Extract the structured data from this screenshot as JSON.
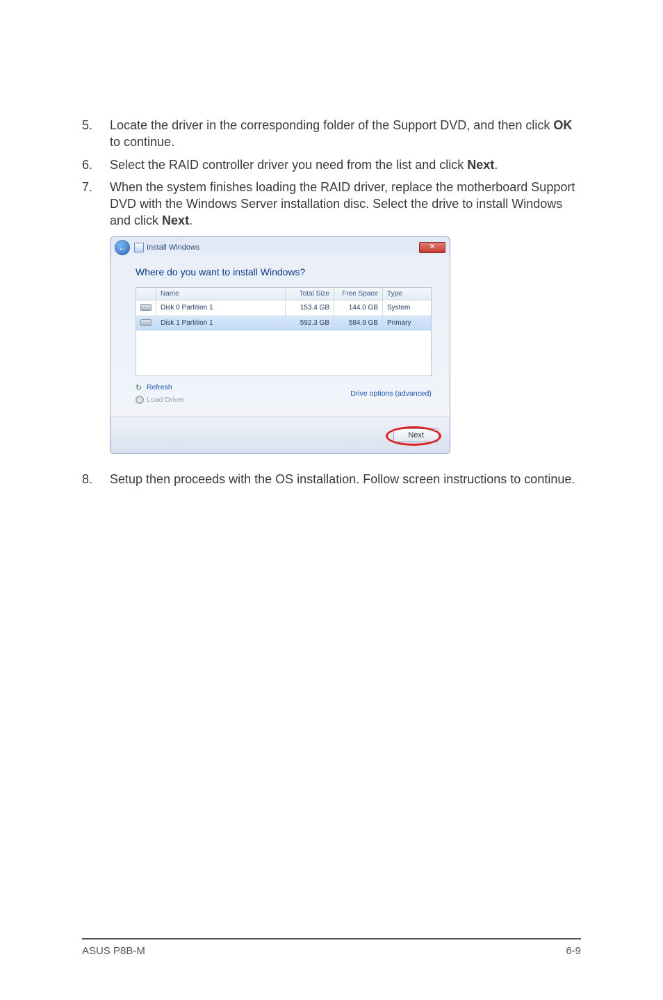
{
  "steps": {
    "5": {
      "num": "5.",
      "text_before": "Locate the driver in the corresponding folder of the Support DVD, and then click ",
      "bold1": "OK",
      "text_after": " to continue."
    },
    "6": {
      "num": "6.",
      "text_before": "Select the RAID controller driver you need from the list and click ",
      "bold1": "Next",
      "text_after": "."
    },
    "7": {
      "num": "7.",
      "text_before": "When the system finishes loading the RAID driver, replace the motherboard Support DVD with the Windows Server installation disc. Select the drive to install Windows and click ",
      "bold1": "Next",
      "text_after": "."
    },
    "8": {
      "num": "8.",
      "text": "Setup then proceeds with the OS installation. Follow screen instructions to continue."
    }
  },
  "dialog": {
    "title": "Install Windows",
    "heading": "Where do you want to install Windows?",
    "columns": {
      "name": "Name",
      "total": "Total Size",
      "free": "Free Space",
      "type": "Type"
    },
    "rows": [
      {
        "name": "Disk 0 Partition 1",
        "total": "153.4 GB",
        "free": "144.0 GB",
        "type": "System",
        "selected": false
      },
      {
        "name": "Disk 1 Partition 1",
        "total": "592.3 GB",
        "free": "584.9 GB",
        "type": "Primary",
        "selected": true
      }
    ],
    "refresh": "Refresh",
    "load_driver": "Load Driver",
    "drive_options": "Drive options (advanced)",
    "next": "Next"
  },
  "footer": {
    "left": "ASUS P8B-M",
    "right": "6-9"
  }
}
